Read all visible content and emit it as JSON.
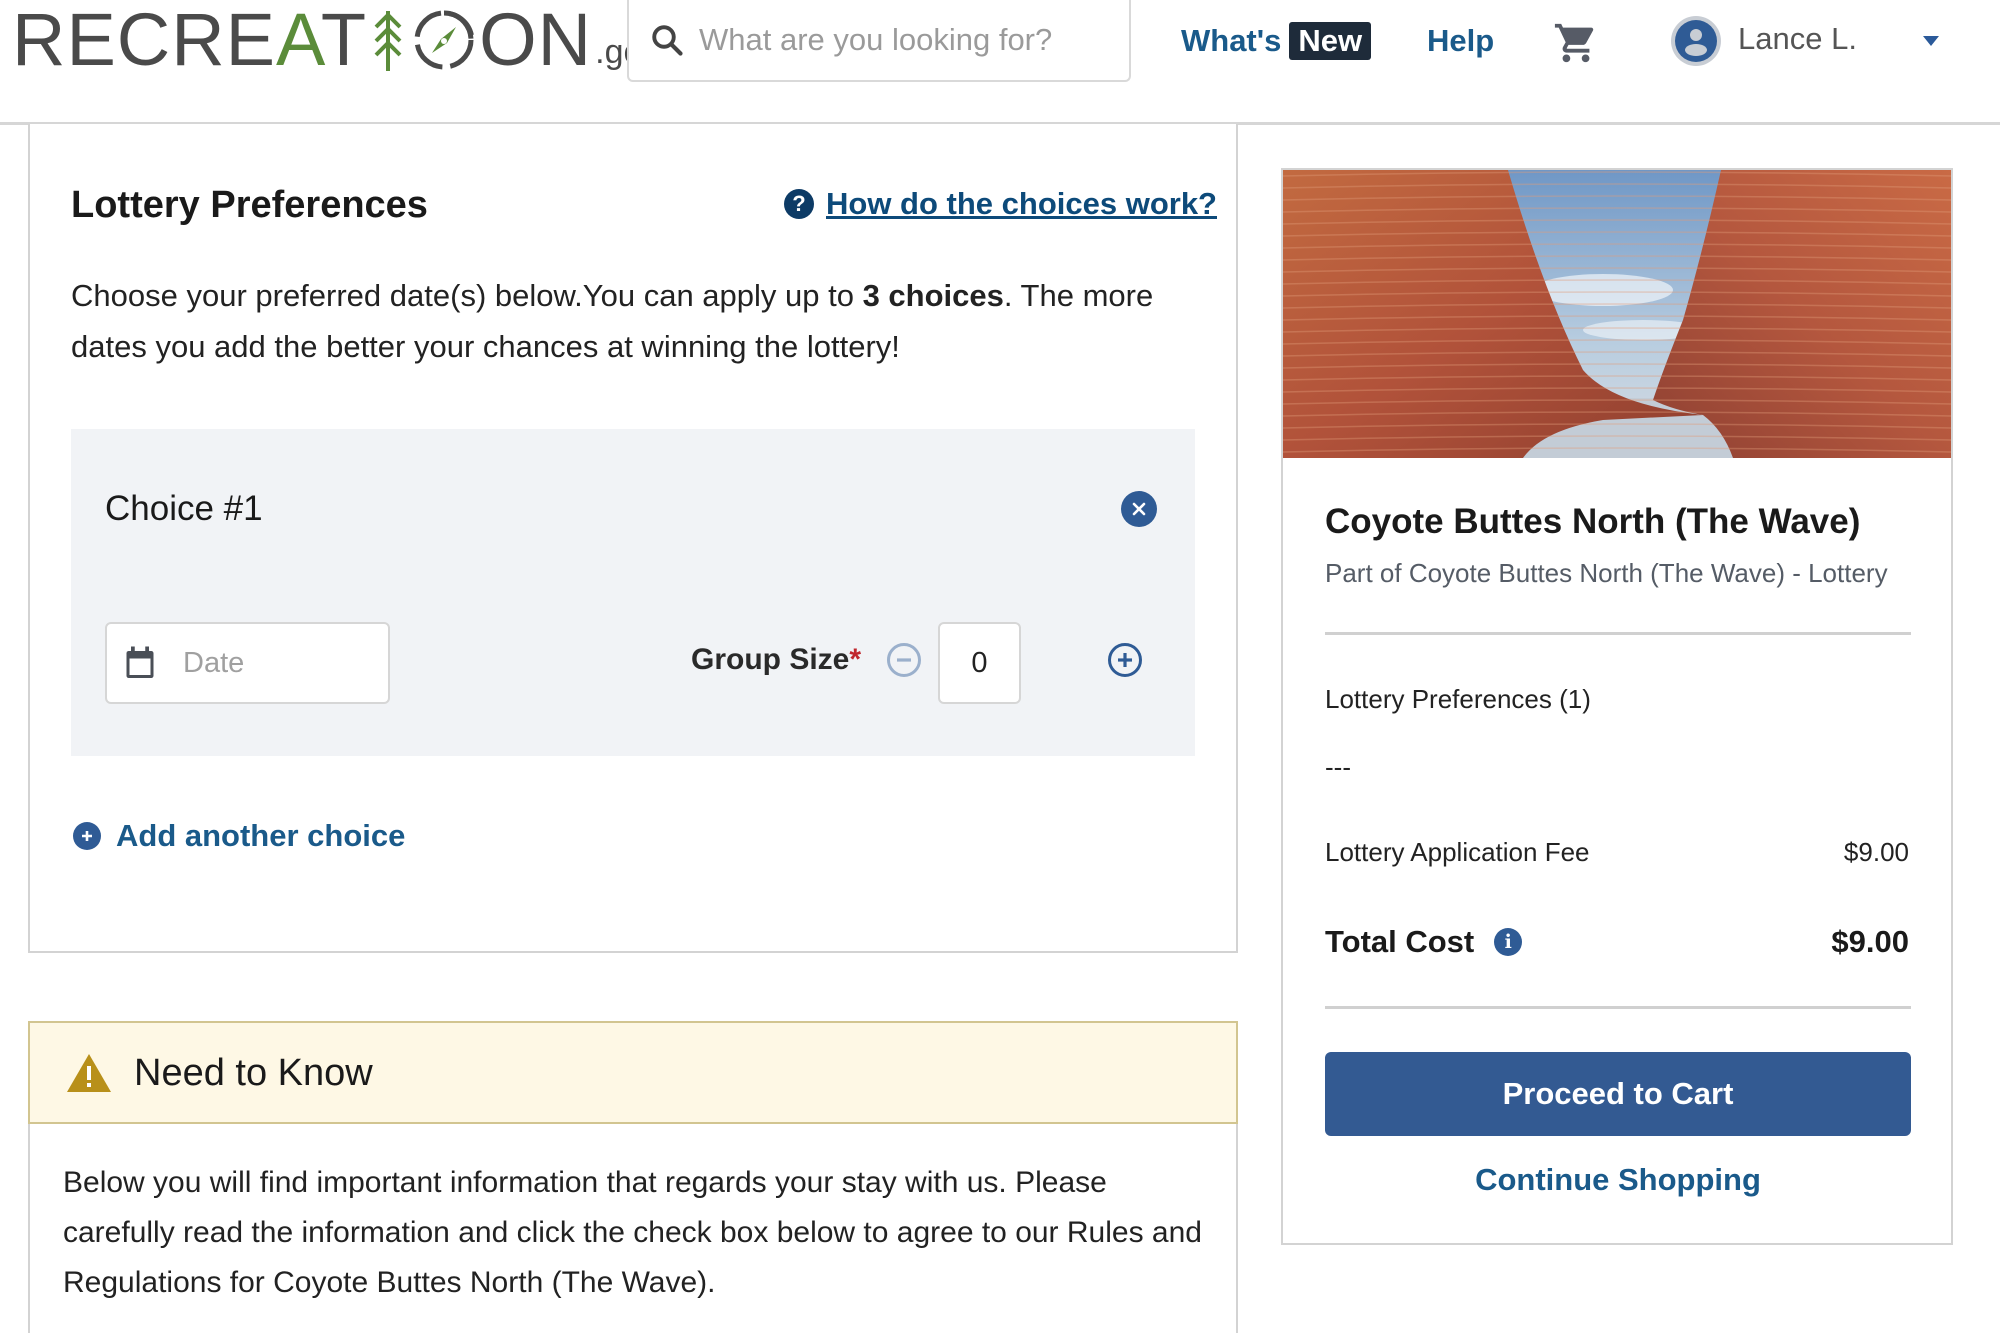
{
  "header": {
    "logo": {
      "text_before": "RECRE",
      "text_green": "A",
      "text_mid": "T",
      "text_tree": "I",
      "text_end": "ON",
      "suffix": ".gov"
    },
    "search": {
      "placeholder": "What are you looking for?",
      "value": ""
    },
    "nav": {
      "whats_label": "What's",
      "new_badge": "New",
      "help_label": "Help"
    },
    "user": {
      "name": "Lance L."
    },
    "icons": {
      "search": "search-icon",
      "cart": "cart-icon",
      "avatar": "user-avatar-icon",
      "caret": "chevron-down-icon"
    }
  },
  "lottery": {
    "title": "Lottery Preferences",
    "help_link": "How do the choices work?",
    "description_pre": "Choose your preferred date(s) below.You can apply up to ",
    "description_bold": "3 choices",
    "description_post": ". The more dates you add the better your chances at winning the lottery!",
    "choices": [
      {
        "title": "Choice #1",
        "date_placeholder": "Date",
        "date_value": "",
        "group_size_label": "Group Size",
        "required_marker": "*",
        "group_size_value": "0"
      }
    ],
    "add_choice_label": "Add another choice"
  },
  "need_to_know": {
    "title": "Need to Know",
    "body": "Below you will find important information that regards your stay with us. Please carefully read the information and click the check box below to agree to our Rules and Regulations for Coyote Buttes North (The Wave)."
  },
  "summary": {
    "title": "Coyote Buttes North (The Wave)",
    "subtitle": "Part of Coyote Buttes North (The Wave) - Lottery",
    "preferences_label": "Lottery Preferences (1)",
    "preferences_value": "---",
    "fee_label": "Lottery Application Fee",
    "fee_value": "$9.00",
    "total_label": "Total Cost",
    "total_value": "$9.00",
    "proceed_label": "Proceed to Cart",
    "continue_label": "Continue Shopping"
  },
  "colors": {
    "brand_blue": "#335a92",
    "link_blue": "#1a5a8a",
    "logo_green": "#5b8c3a",
    "warning_bg": "#fef8e5",
    "warning_icon": "#b8901a",
    "required_red": "#c0272d",
    "choice_bg": "#f1f3f6"
  }
}
